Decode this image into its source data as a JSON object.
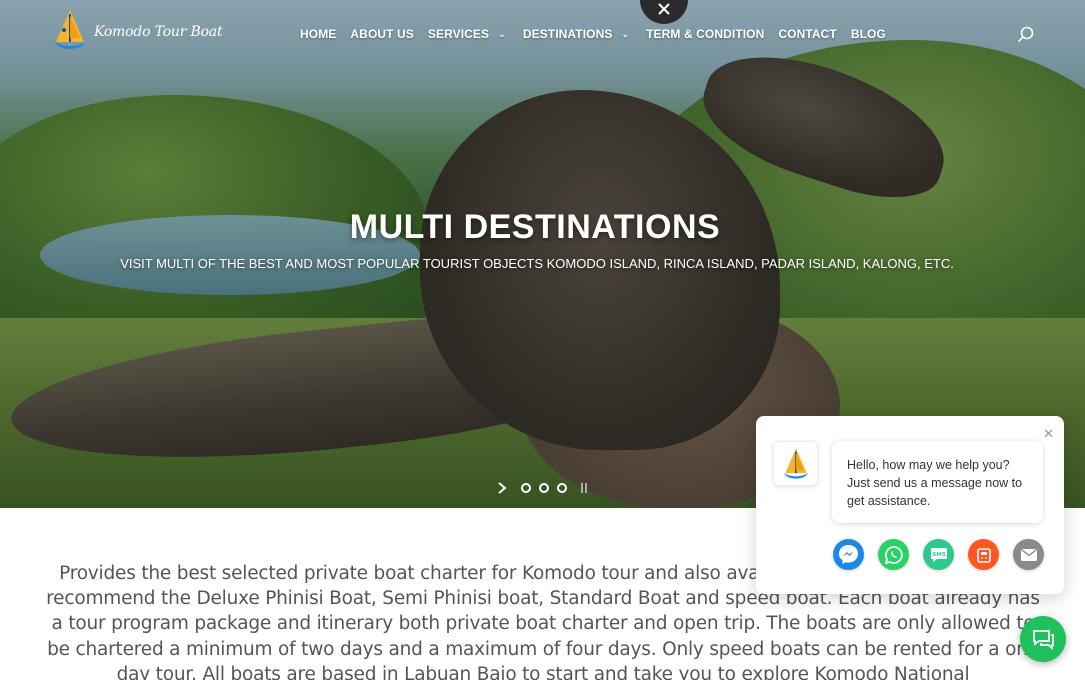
{
  "brand": {
    "name": "Komodo Tour Boat"
  },
  "nav": {
    "items": [
      {
        "label": "HOME",
        "has_dropdown": false
      },
      {
        "label": "ABOUT US",
        "has_dropdown": false
      },
      {
        "label": "SERVICES",
        "has_dropdown": true
      },
      {
        "label": "DESTINATIONS",
        "has_dropdown": true
      },
      {
        "label": "TERM & CONDITION",
        "has_dropdown": false
      },
      {
        "label": "CONTACT",
        "has_dropdown": false
      },
      {
        "label": "BLOG",
        "has_dropdown": false
      }
    ],
    "search_icon": "search-icon",
    "close_icon": "close-icon"
  },
  "hero": {
    "title": "MULTI DESTINATIONS",
    "subtitle": "VISIT MULTI OF THE BEST AND MOST POPULAR TOURIST OBJECTS KOMODO ISLAND, RINCA ISLAND, PADAR ISLAND, KALONG, ETC.",
    "slides_count": 3,
    "active_slide": 1
  },
  "intro": {
    "text": "Provides the best selected private boat charter for Komodo tour and also available komodo open trip. Only recommend the Deluxe Phinisi Boat, Semi Phinisi boat, Standard Boat and speed boat. Each boat already has a tour program package and itinerary both private boat charter and open trip. The boats are only allowed to be chartered a minimum of two days and a maximum of four days. Only speed boats can be rented for a one day tour. All boats are based in Labuan Bajo to start and  take you to explore Komodo National"
  },
  "chat": {
    "greeting": "Hello, how may we help you? Just send us a message now to get assistance.",
    "channels": [
      "messenger-icon",
      "whatsapp-icon",
      "sms-icon",
      "phone-icon",
      "email-icon"
    ],
    "colors": {
      "messenger": "#1e88e5",
      "whatsapp": "#25d366",
      "sms": "#2dc98c",
      "phone": "#ff5722",
      "email": "#8a8a8a",
      "fab": "#20c15c"
    }
  }
}
